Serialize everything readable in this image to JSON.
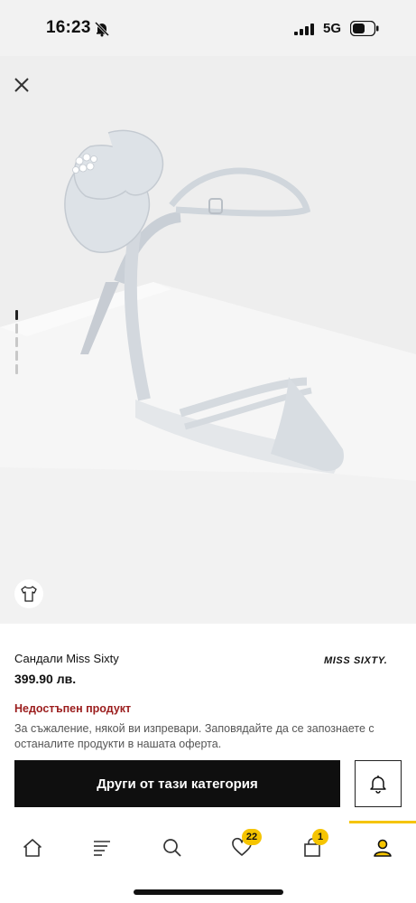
{
  "status_bar": {
    "time": "16:23",
    "network": "5G",
    "icons": [
      "bell-off-icon",
      "signal-icon",
      "battery-icon"
    ]
  },
  "gallery": {
    "icons": [
      "close-icon",
      "tshirt-icon"
    ]
  },
  "product": {
    "name": "Сандали Miss Sixty",
    "brand": "MISS SIXTY.",
    "price": "399.90 лв.",
    "availability": "Недостъпен продукт",
    "note": "За съжаление, някой ви изпревари. Заповядайте да се запознаете с останалите продукти в нашата оферта."
  },
  "actions": {
    "cta_label": "Други от тази категория",
    "notify_icon": "bell-icon"
  },
  "bottom_nav": {
    "items": [
      {
        "name": "home",
        "icon": "home-icon"
      },
      {
        "name": "categories",
        "icon": "menu-icon"
      },
      {
        "name": "search",
        "icon": "search-icon"
      },
      {
        "name": "favorites",
        "icon": "heart-icon",
        "badge": "22"
      },
      {
        "name": "cart",
        "icon": "bag-icon",
        "badge": "1"
      },
      {
        "name": "profile",
        "icon": "user-icon"
      }
    ]
  },
  "colors": {
    "accent": "#f5c400",
    "error": "#9b1d1d",
    "cta_bg": "#0f0f0f"
  }
}
